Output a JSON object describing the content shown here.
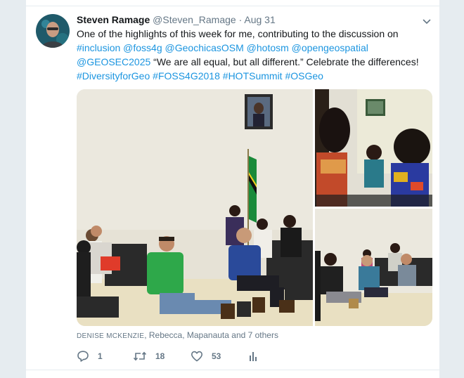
{
  "tweet": {
    "author_name": "Steven Ramage",
    "author_handle": "@Steven_Ramage",
    "separator": "·",
    "date": "Aug 31",
    "lines": [
      [
        {
          "t": "One of the highlights of this week for me, contributing to the discussion on",
          "tag": false
        }
      ],
      [
        {
          "t": "#inclusion",
          "tag": true
        },
        {
          "t": " ",
          "tag": false
        },
        {
          "t": "@foss4g",
          "tag": true
        },
        {
          "t": " ",
          "tag": false
        },
        {
          "t": "@GeochicasOSM",
          "tag": true
        },
        {
          "t": " ",
          "tag": false
        },
        {
          "t": "@hotosm",
          "tag": true
        },
        {
          "t": " ",
          "tag": false
        },
        {
          "t": "@opengeospatial",
          "tag": true
        }
      ],
      [
        {
          "t": "@GEOSEC2025",
          "tag": true
        },
        {
          "t": " “We are all equal, but all different.” Celebrate the differences!",
          "tag": false
        }
      ],
      [
        {
          "t": "#DiversityforGeo",
          "tag": true
        },
        {
          "t": " ",
          "tag": false
        },
        {
          "t": "#FOSS4G2018",
          "tag": true
        },
        {
          "t": " ",
          "tag": false
        },
        {
          "t": "#HOTSummit",
          "tag": true
        },
        {
          "t": " ",
          "tag": false
        },
        {
          "t": "#OSGeo",
          "tag": true
        }
      ]
    ],
    "likers_first": "DENISE MCKENZIE",
    "likers_rest": ", Rebecca, Mapanauta and 7 others",
    "actions": {
      "reply_count": "1",
      "retweet_count": "18",
      "like_count": "53"
    }
  },
  "icons": {
    "more": "chevron-down-icon",
    "reply": "reply-icon",
    "retweet": "retweet-icon",
    "like": "heart-icon",
    "analytics": "analytics-icon"
  },
  "colors": {
    "link": "#1b95e0",
    "muted": "#657786",
    "text": "#14171a",
    "background": "#e6ecf0"
  }
}
